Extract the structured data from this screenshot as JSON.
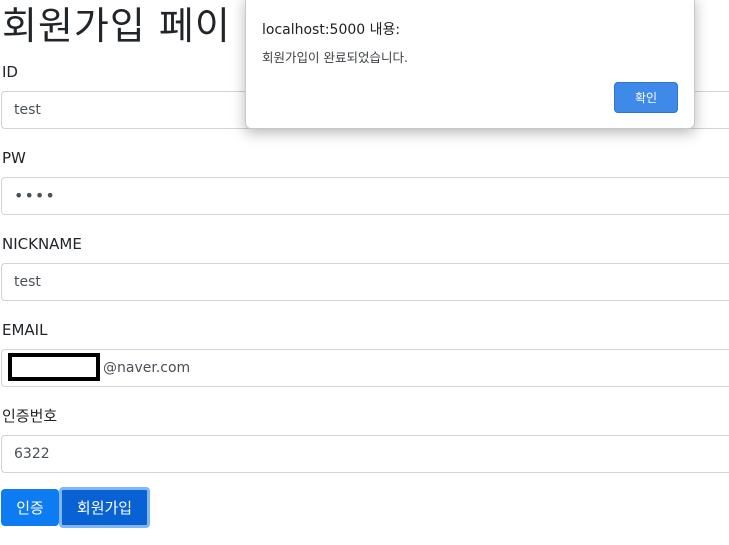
{
  "page": {
    "title": "회원가입 페이"
  },
  "form": {
    "id": {
      "label": "ID",
      "value": "test"
    },
    "pw": {
      "label": "PW",
      "value": "••••"
    },
    "nickname": {
      "label": "NICKNAME",
      "value": "test"
    },
    "email": {
      "label": "EMAIL",
      "domain": "@naver.com"
    },
    "code": {
      "label": "인증번호",
      "value": "6322"
    }
  },
  "buttons": {
    "verify": "인증",
    "signup": "회원가입"
  },
  "dialog": {
    "origin": "localhost:5000 내용:",
    "message": "회원가입이 완료되었습니다.",
    "ok_label": "확인"
  },
  "colors": {
    "primary": "#0d7cf2",
    "dialog_button": "#3f8ae8"
  }
}
